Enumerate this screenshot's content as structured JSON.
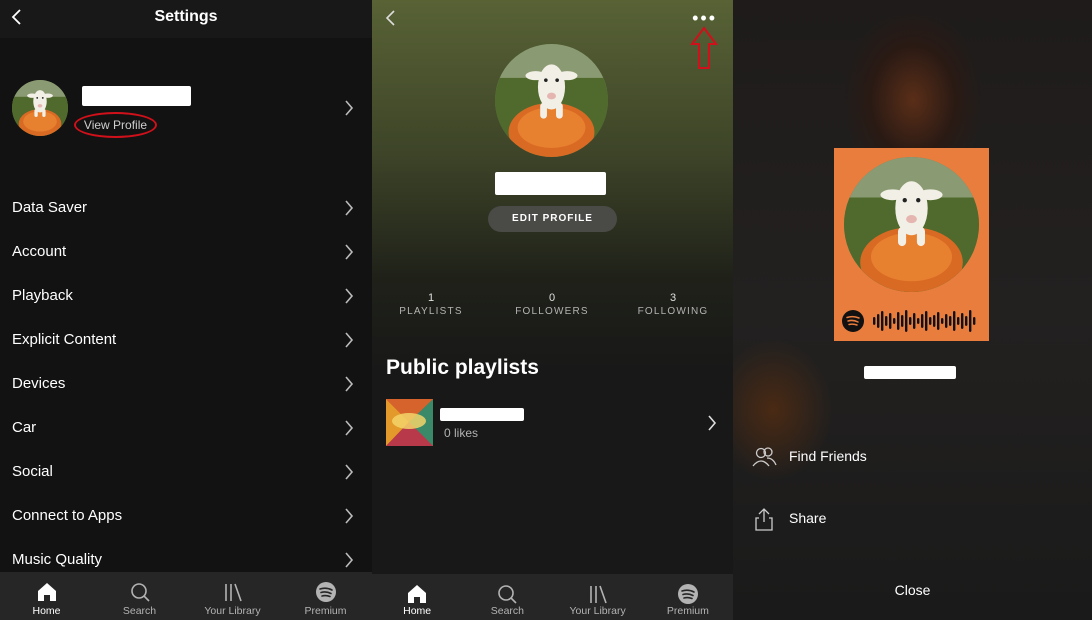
{
  "settings": {
    "title": "Settings",
    "view_profile": "View Profile",
    "menu": [
      {
        "label": "Data Saver"
      },
      {
        "label": "Account"
      },
      {
        "label": "Playback"
      },
      {
        "label": "Explicit Content"
      },
      {
        "label": "Devices"
      },
      {
        "label": "Car"
      },
      {
        "label": "Social"
      },
      {
        "label": "Connect to Apps"
      },
      {
        "label": "Music Quality"
      }
    ]
  },
  "nav": {
    "home": "Home",
    "search": "Search",
    "library": "Your Library",
    "premium": "Premium"
  },
  "profile": {
    "more_icon": "•••",
    "edit_button": "EDIT PROFILE",
    "stats": [
      {
        "value": "1",
        "label": "PLAYLISTS"
      },
      {
        "value": "0",
        "label": "FOLLOWERS"
      },
      {
        "value": "3",
        "label": "FOLLOWING"
      }
    ],
    "public_playlists_title": "Public playlists",
    "playlist": {
      "likes": "0 likes"
    }
  },
  "share_sheet": {
    "find_friends": "Find Friends",
    "share": "Share",
    "close": "Close"
  },
  "colors": {
    "accent_red": "#d0101a",
    "card_orange": "#e97d3e",
    "spotify_green": "#1db954"
  },
  "icons": {
    "back": "chevron-left-icon",
    "more": "more-horizontal-icon",
    "home": "home-icon",
    "search": "search-icon",
    "library": "library-icon",
    "premium": "spotify-logo-icon",
    "find_friends": "users-icon",
    "share": "share-icon"
  }
}
